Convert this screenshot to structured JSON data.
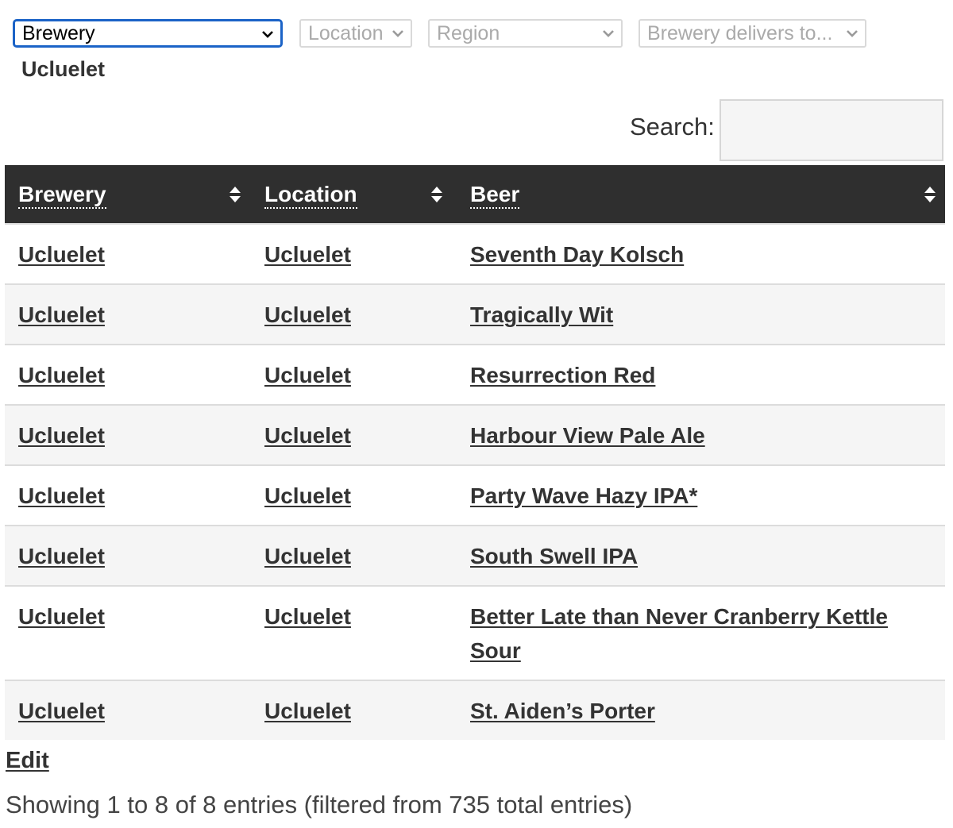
{
  "filters": {
    "brewery": "Brewery",
    "location": "Location",
    "region": "Region",
    "delivers": "Brewery delivers to..."
  },
  "heading": "Ucluelet",
  "search": {
    "label": "Search:",
    "value": ""
  },
  "table": {
    "headers": [
      "Brewery",
      "Location",
      "Beer"
    ],
    "rows": [
      [
        "Ucluelet",
        "Ucluelet",
        "Seventh Day Kolsch"
      ],
      [
        "Ucluelet",
        "Ucluelet",
        "Tragically Wit"
      ],
      [
        "Ucluelet",
        "Ucluelet",
        "Resurrection Red"
      ],
      [
        "Ucluelet",
        "Ucluelet",
        "Harbour View Pale Ale"
      ],
      [
        "Ucluelet",
        "Ucluelet",
        "Party Wave Hazy IPA*"
      ],
      [
        "Ucluelet",
        "Ucluelet",
        "South Swell IPA"
      ],
      [
        "Ucluelet",
        "Ucluelet",
        "Better Late than Never Cranberry Kettle Sour"
      ],
      [
        "Ucluelet",
        "Ucluelet",
        "St. Aiden’s Porter"
      ]
    ]
  },
  "edit_label": "Edit",
  "info": "Showing 1 to 8 of 8 entries (filtered from 735 total entries)",
  "icons": {
    "dropdown": "chevron-down-icon",
    "sort": "sort-icon"
  },
  "colors": {
    "header_bg": "#2f2f2f",
    "focus": "#1b63c7",
    "stripe": "#f5f5f5"
  }
}
